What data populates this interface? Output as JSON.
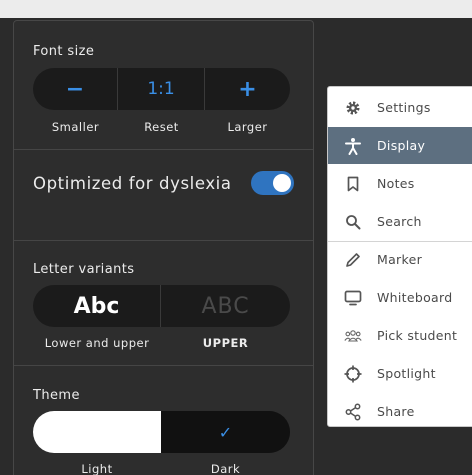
{
  "colors": {
    "accent": "#3a8fe6",
    "toggle_on": "#2f74c0",
    "menu_active": "#5d6f80",
    "panel_bg": "#2d2d2d"
  },
  "font_size": {
    "title": "Font size",
    "decrease_symbol": "−",
    "ratio": "1:1",
    "increase_symbol": "+",
    "smaller_label": "Smaller",
    "reset_label": "Reset",
    "larger_label": "Larger"
  },
  "dyslexia": {
    "label": "Optimized for dyslexia",
    "enabled": true
  },
  "letter_variants": {
    "title": "Letter variants",
    "options": [
      {
        "sample": "Abc",
        "label": "Lower and upper",
        "selected": true
      },
      {
        "sample": "ABC",
        "label": "UPPER",
        "selected": false
      }
    ]
  },
  "theme": {
    "title": "Theme",
    "check_symbol": "✓",
    "light_label": "Light",
    "dark_label": "Dark",
    "selected": "Dark"
  },
  "menu": {
    "items": [
      {
        "label": "Settings",
        "icon": "gear-icon",
        "active": false
      },
      {
        "label": "Display",
        "icon": "accessibility-icon",
        "active": true
      },
      {
        "label": "Notes",
        "icon": "bookmark-icon",
        "active": false
      },
      {
        "label": "Search",
        "icon": "search-icon",
        "active": false
      },
      {
        "label": "Marker",
        "icon": "pencil-icon",
        "active": false
      },
      {
        "label": "Whiteboard",
        "icon": "monitor-icon",
        "active": false
      },
      {
        "label": "Pick student",
        "icon": "group-icon",
        "active": false
      },
      {
        "label": "Spotlight",
        "icon": "crosshair-icon",
        "active": false
      },
      {
        "label": "Share",
        "icon": "share-icon",
        "active": false
      }
    ]
  }
}
